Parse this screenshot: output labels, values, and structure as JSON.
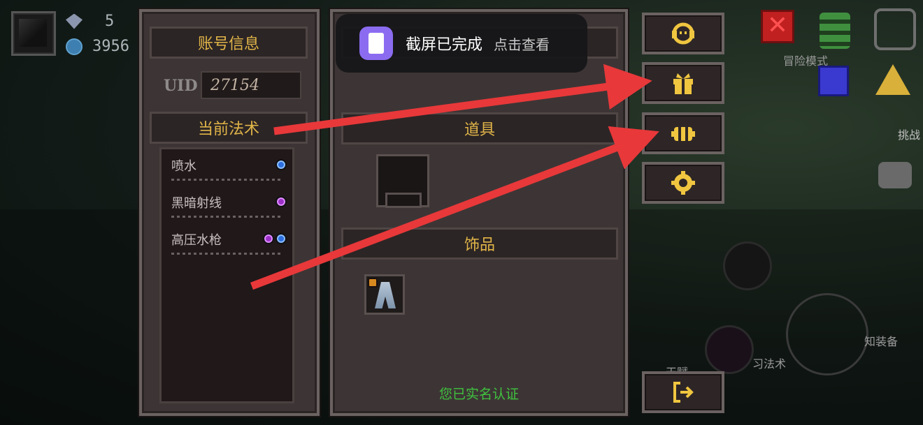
{
  "hud": {
    "gems": "5",
    "coins": "3956"
  },
  "left_panel": {
    "title": "账号信息",
    "uid_label": "UID",
    "uid_value": "27154",
    "spells_title": "当前法术",
    "spells": [
      {
        "name": "喷水",
        "elements": [
          "water"
        ]
      },
      {
        "name": "黑暗射线",
        "elements": [
          "dark"
        ]
      },
      {
        "name": "高压水枪",
        "elements": [
          "dark",
          "water"
        ]
      }
    ]
  },
  "mid_panel": {
    "items_title": "道具",
    "accessories_title": "饰品",
    "realname_status": "您已实名认证"
  },
  "side_buttons": [
    {
      "name": "support",
      "icon": "headset-icon"
    },
    {
      "name": "gift",
      "icon": "gift-icon"
    },
    {
      "name": "bee",
      "icon": "bee-icon"
    },
    {
      "name": "settings",
      "icon": "gear-icon"
    },
    {
      "name": "exit",
      "icon": "exit-icon"
    }
  ],
  "toast": {
    "title": "截屏已完成",
    "action": "点击查看"
  },
  "right_hud": {
    "mode_label": "冒险模式",
    "challenge_label": "挑战",
    "equip_label": "知装备",
    "spell_label": "习法术",
    "talent_label": "天赋"
  },
  "colors": {
    "accent_gold": "#e0b548",
    "arrow_red": "#e8383a",
    "verified_green": "#3fc23f"
  }
}
